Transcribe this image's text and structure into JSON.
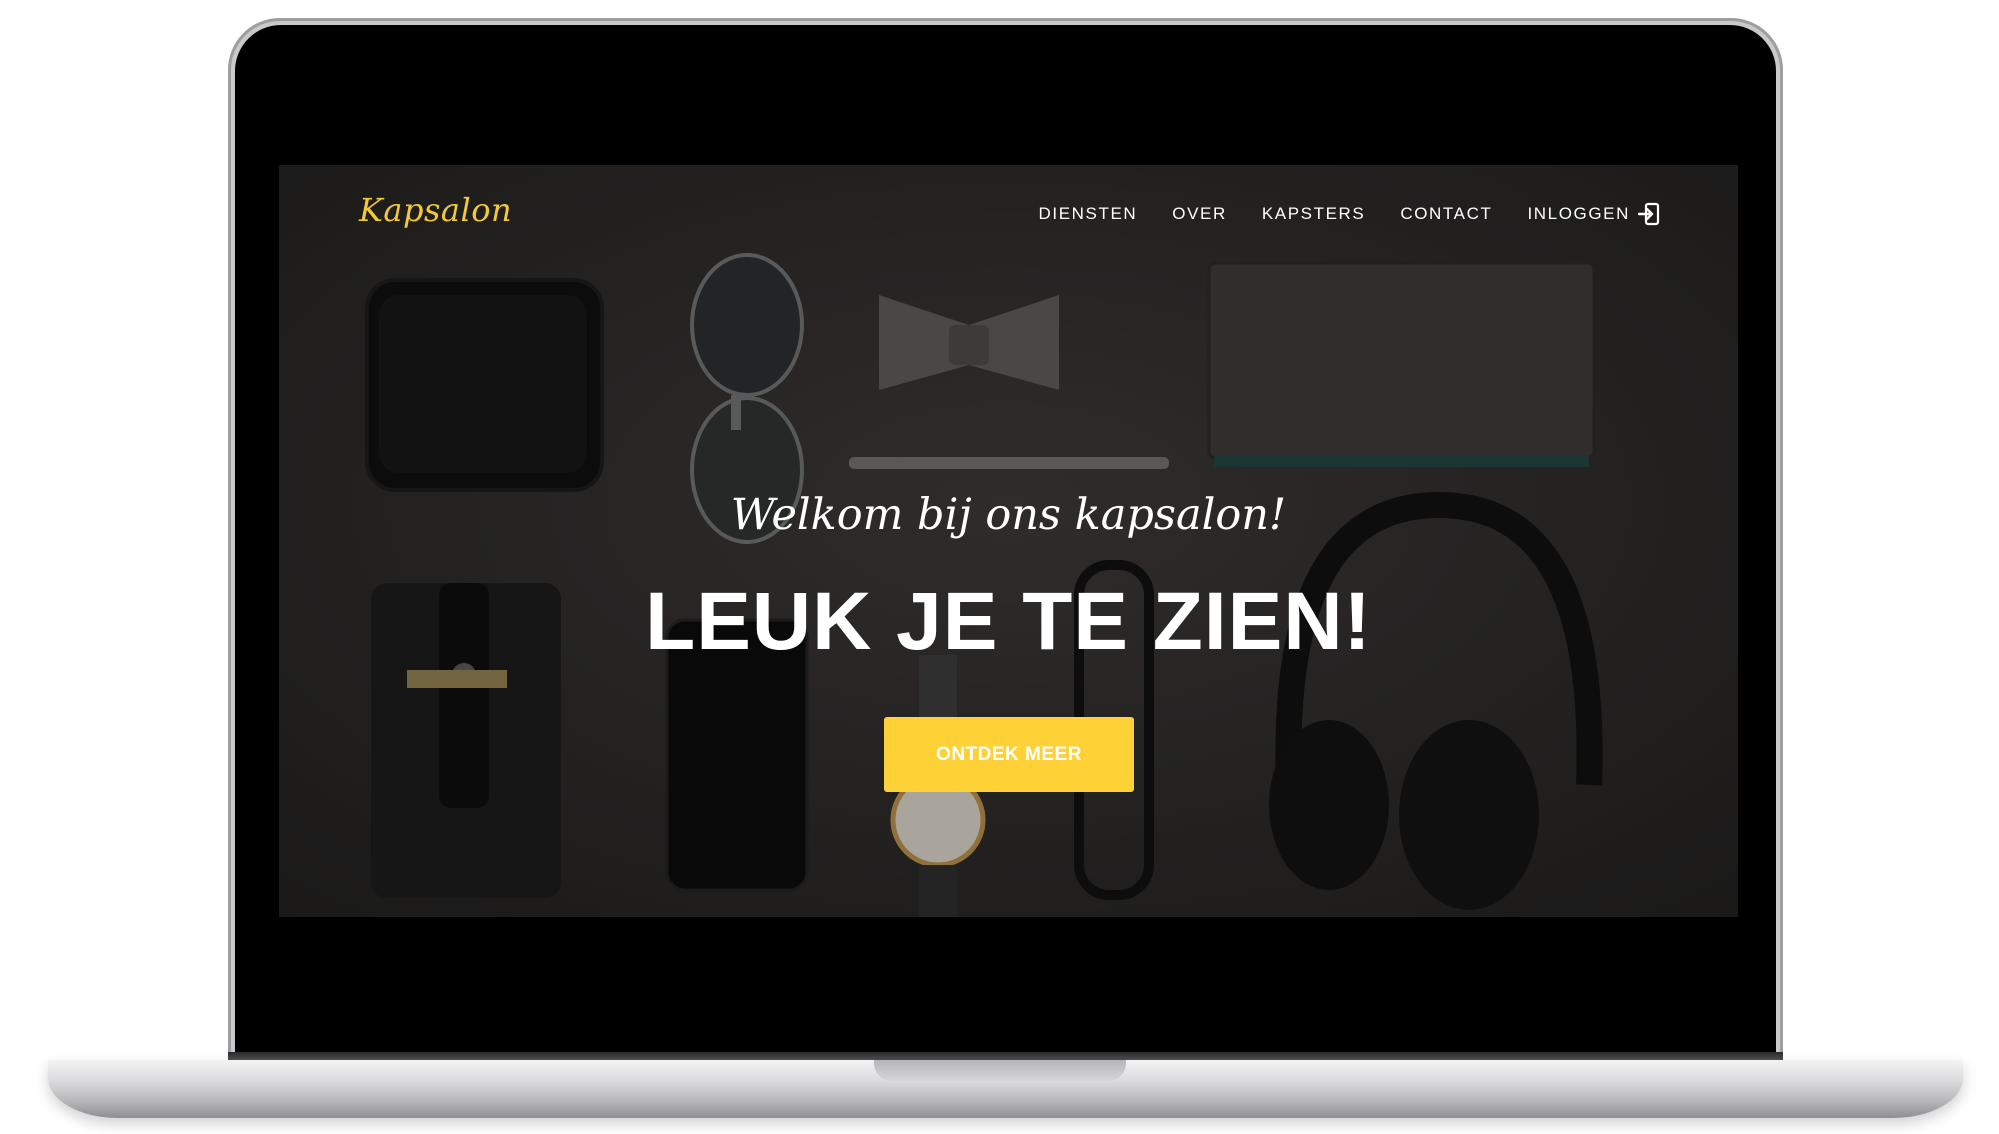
{
  "brand": {
    "logo_text": "Kapsalon",
    "accent_color": "#fed136"
  },
  "nav": {
    "items": [
      {
        "label": "DIENSTEN"
      },
      {
        "label": "OVER"
      },
      {
        "label": "KAPSTERS"
      },
      {
        "label": "CONTACT"
      },
      {
        "label": "INLOGGEN",
        "icon": "sign-in-icon"
      }
    ]
  },
  "hero": {
    "tagline": "Welkom bij ons kapsalon!",
    "headline": "LEUK JE TE ZIEN!",
    "cta_label": "ONTDEK MEER",
    "background": "flat-lay-accessories-photo"
  }
}
